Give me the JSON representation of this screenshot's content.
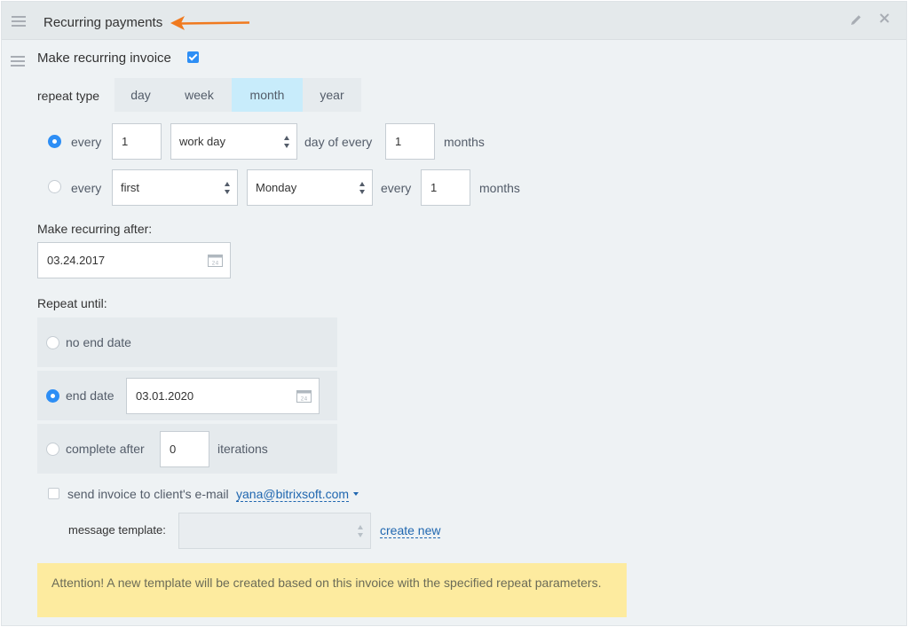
{
  "header": {
    "title": "Recurring payments",
    "edit_icon": "pencil-icon",
    "close_icon": "close-icon",
    "menu_icon": "hamburger-icon"
  },
  "make_recurring": {
    "label": "Make recurring invoice",
    "checked": true
  },
  "repeat_type": {
    "label": "repeat type",
    "options": [
      "day",
      "week",
      "month",
      "year"
    ],
    "selected": "month"
  },
  "rule1": {
    "checked": true,
    "every_label": "every",
    "count": "1",
    "unit_select": "work day",
    "middle_label": "day of every",
    "months_count": "1",
    "months_label": "months"
  },
  "rule2": {
    "checked": false,
    "every_label": "every",
    "ordinal_select": "first",
    "weekday_select": "Monday",
    "every2_label": "every",
    "months_count": "1",
    "months_label": "months"
  },
  "recurring_after": {
    "label": "Make recurring after:",
    "date": "03.24.2017"
  },
  "repeat_until": {
    "label": "Repeat until:",
    "no_end_label": "no end date",
    "end_date_label": "end date",
    "end_date_value": "03.01.2020",
    "complete_after_label": "complete after",
    "iterations_value": "0",
    "iterations_label": "iterations",
    "selected": "end date"
  },
  "send_invoice": {
    "label": "send invoice to client's e-mail",
    "email": "yana@bitrixsoft.com",
    "checked": false
  },
  "message_template": {
    "label": "message template:",
    "value": "",
    "create_new": "create new"
  },
  "notice": {
    "text": "Attention! A new template will be created based on this invoice with the specified repeat parameters."
  },
  "colors": {
    "accent": "#2d8ef5",
    "active_tab": "#c8ecfb",
    "notice_bg": "#fdeb9f",
    "arrow": "#f07a1f",
    "link": "#2067b0"
  }
}
